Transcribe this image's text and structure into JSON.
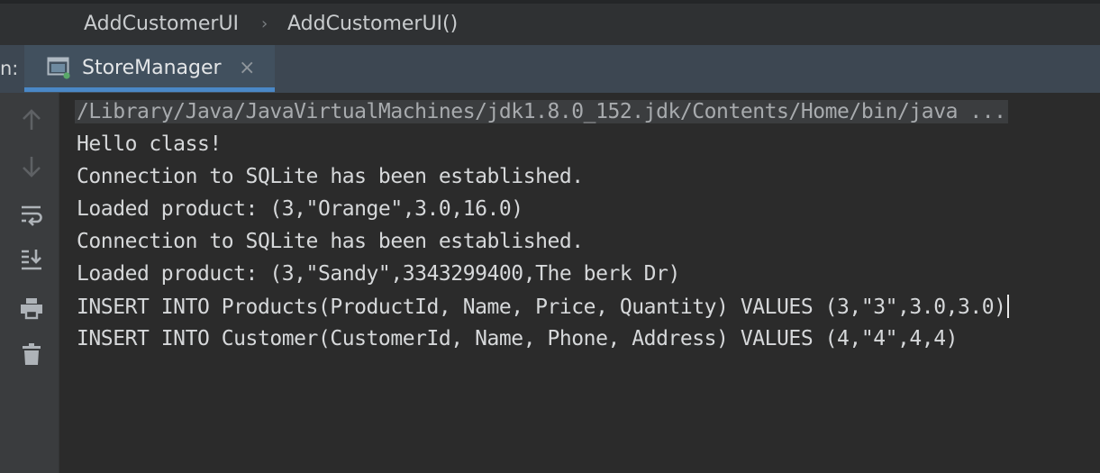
{
  "breadcrumb": {
    "class_name": "AddCustomerUI",
    "method_name": "AddCustomerUI()",
    "separator": "›"
  },
  "run_panel": {
    "label": "n:",
    "tab": {
      "title": "StoreManager",
      "close": "×",
      "icon": "console-window-icon"
    }
  },
  "toolbar": {
    "icons": [
      "arrow-up-icon",
      "arrow-down-icon",
      "soft-wrap-icon",
      "scroll-to-end-icon",
      "print-icon",
      "trash-icon"
    ]
  },
  "console": {
    "lines": [
      "/Library/Java/JavaVirtualMachines/jdk1.8.0_152.jdk/Contents/Home/bin/java ...",
      "Hello class!",
      "Connection to SQLite has been established.",
      "Loaded product: (3,\"Orange\",3.0,16.0)",
      "Connection to SQLite has been established.",
      "Loaded product: (3,\"Sandy\",3343299400,The berk Dr)",
      "INSERT INTO Products(ProductId, Name, Price, Quantity) VALUES (3,\"3\",3.0,3.0)",
      "INSERT INTO Customer(CustomerId, Name, Phone, Address) VALUES (4,\"4\",4,4)"
    ]
  },
  "colors": {
    "background": "#2b2b2b",
    "tab_underline": "#4a88c7",
    "running_dot": "#59a869"
  }
}
